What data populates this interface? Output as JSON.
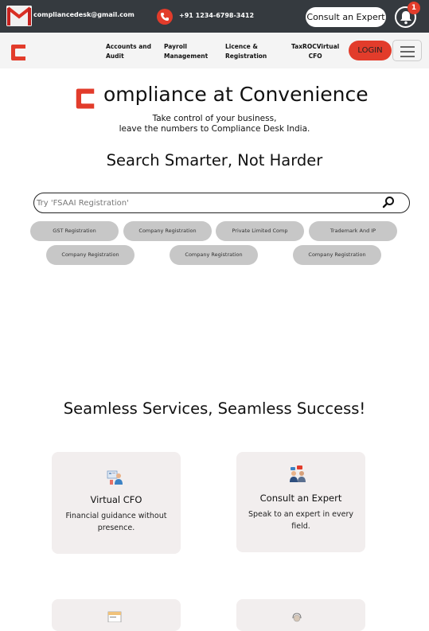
{
  "topbar": {
    "email": "compliancedesk@gmail.com",
    "phone": "+91 1234-6798-3412",
    "consult_label": "Consult an Expert",
    "notification_count": "1"
  },
  "nav": {
    "links": [
      {
        "line1": "Accounts and",
        "line2": "Audit"
      },
      {
        "line1": "Payroll",
        "line2": "Management"
      },
      {
        "line1": "Licence &",
        "line2": "Registration"
      },
      {
        "line1": "TaxROCVirtual",
        "line2": "CFO"
      }
    ],
    "login_label": "LOGIN"
  },
  "hero": {
    "title": "ompliance at Convenience",
    "subtitle_line1": "Take control of your business,",
    "subtitle_line2": "leave the numbers to Compliance Desk India."
  },
  "search": {
    "heading": "Search Smarter, Not Harder",
    "placeholder": "Try 'FSAAI Registration'",
    "chips": [
      "GST Registration",
      "Company Registration",
      "Private Limited Comp",
      "Trademark And IP",
      "Company Registration",
      "Company Registration",
      "Company Registration"
    ]
  },
  "services": {
    "heading": "Seamless Services, Seamless Success!",
    "cards": [
      {
        "title": "Virtual CFO",
        "desc_line1": "Financial guidance without",
        "desc_line2": "presence.",
        "icon": "virtual-cfo-icon"
      },
      {
        "title": "Consult an Expert",
        "desc_line1": "Speak to an expert in every",
        "desc_line2": "field.",
        "icon": "consult-expert-icon"
      },
      {
        "title": "",
        "desc_line1": "",
        "desc_line2": "",
        "icon": "tax-document-icon"
      },
      {
        "title": "",
        "desc_line1": "",
        "desc_line2": "",
        "icon": "support-person-icon"
      }
    ]
  },
  "colors": {
    "brand_red": "#e23c2b",
    "topbar_bg": "#353a3f",
    "chip_bg": "#c7c7c7",
    "card_bg": "#f2eeee"
  }
}
